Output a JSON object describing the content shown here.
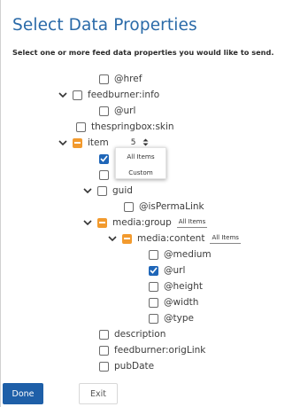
{
  "dialog": {
    "title": "Select Data Properties",
    "subtitle": "Select one or more feed data properties you would like to send."
  },
  "tree": {
    "href": "@href",
    "feedburner_info": "feedburner:info",
    "url_1": "@url",
    "thespringbox_skin": "thespringbox:skin",
    "item": "item",
    "item_count": "5",
    "guid": "guid",
    "is_perma_link": "@isPermaLink",
    "media_group": "media:group",
    "media_group_scope": "All Items",
    "media_content": "media:content",
    "media_content_scope": "All Items",
    "medium": "@medium",
    "url_2": "@url",
    "height": "@height",
    "width": "@width",
    "type": "@type",
    "description": "description",
    "feedburner_orig_link": "feedburner:origLink",
    "pub_date": "pubDate"
  },
  "dropdown": {
    "options": [
      "All Items",
      "Custom"
    ]
  },
  "buttons": {
    "done": "Done",
    "exit": "Exit"
  },
  "colors": {
    "accent": "#2a6aa8",
    "checked": "#1f66b8",
    "partial": "#f29a2e",
    "primary_button": "#1e5fa8"
  }
}
